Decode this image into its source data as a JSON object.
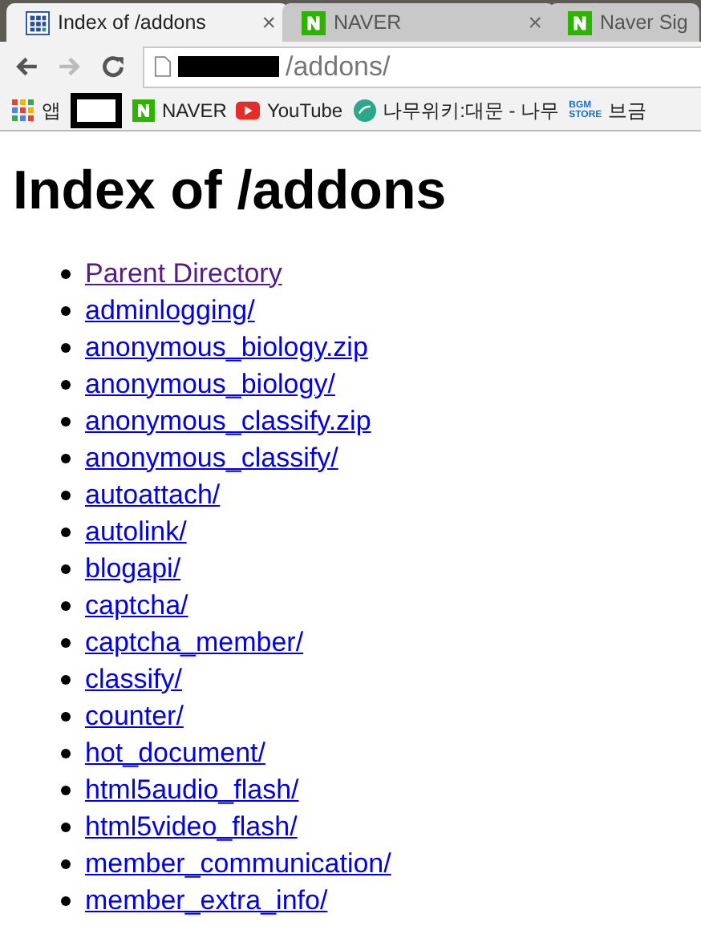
{
  "tabs": [
    {
      "title": "Index of /addons",
      "kind": "grid",
      "close": "×",
      "selected": true
    },
    {
      "title": "NAVER",
      "kind": "naver",
      "close": "×",
      "selected": false
    },
    {
      "title": "Naver Sig",
      "kind": "naver",
      "selected": false
    }
  ],
  "address": {
    "path": "/addons/"
  },
  "bookmarks": [
    {
      "kind": "apps",
      "label": "앱"
    },
    {
      "kind": "redacted"
    },
    {
      "kind": "naver",
      "label": "NAVER"
    },
    {
      "kind": "youtube",
      "label": "YouTube"
    },
    {
      "kind": "namu",
      "label": "나무위키:대문 - 나무"
    },
    {
      "kind": "bgm",
      "logo": [
        "BGM",
        "STORE"
      ],
      "label": "브금"
    }
  ],
  "heading": "Index of /addons",
  "links": [
    {
      "text": "Parent Directory",
      "visited": true
    },
    {
      "text": "adminlogging/",
      "visited": false
    },
    {
      "text": "anonymous_biology.zip",
      "visited": false
    },
    {
      "text": "anonymous_biology/",
      "visited": false
    },
    {
      "text": "anonymous_classify.zip",
      "visited": false
    },
    {
      "text": "anonymous_classify/",
      "visited": false
    },
    {
      "text": "autoattach/",
      "visited": false
    },
    {
      "text": "autolink/",
      "visited": false
    },
    {
      "text": "blogapi/",
      "visited": false
    },
    {
      "text": "captcha/",
      "visited": false
    },
    {
      "text": "captcha_member/",
      "visited": false
    },
    {
      "text": "classify/",
      "visited": false
    },
    {
      "text": "counter/",
      "visited": false
    },
    {
      "text": "hot_document/",
      "visited": false
    },
    {
      "text": "html5audio_flash/",
      "visited": false
    },
    {
      "text": "html5video_flash/",
      "visited": false
    },
    {
      "text": "member_communication/",
      "visited": false
    },
    {
      "text": "member_extra_info/",
      "visited": false
    }
  ]
}
